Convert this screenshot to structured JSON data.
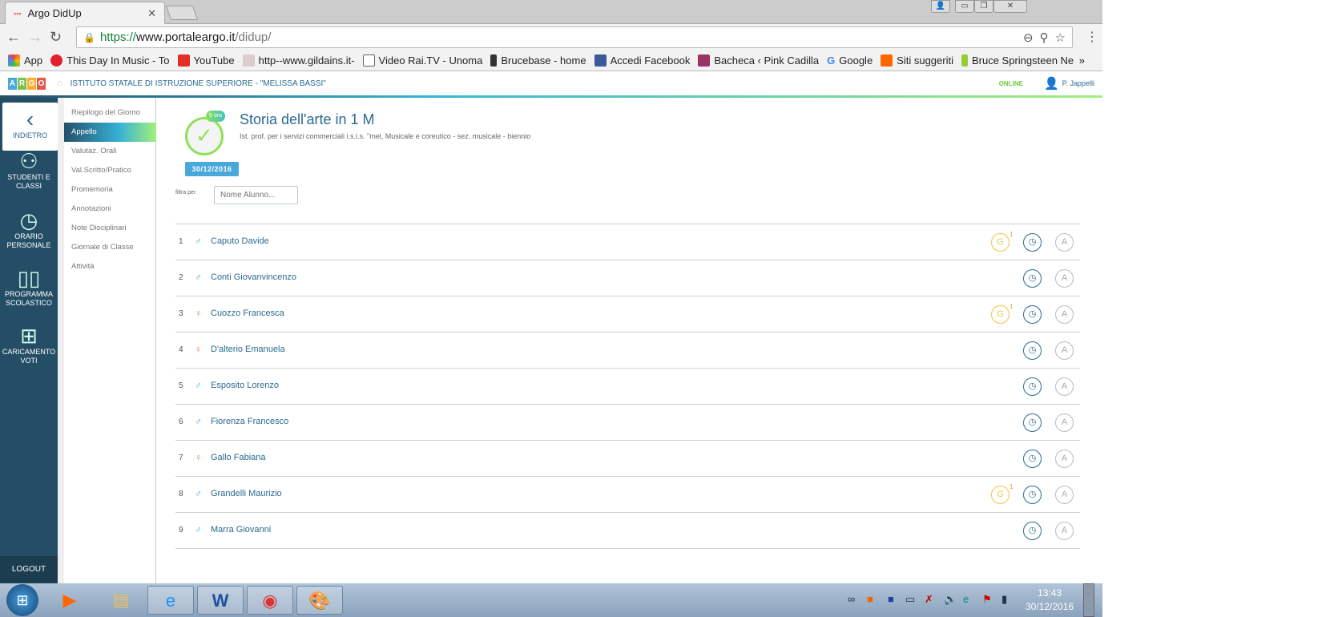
{
  "browser": {
    "tab_title": "Argo DidUp",
    "url_scheme": "https://",
    "url_host": "www.portaleargo.it",
    "url_path": "/didup/",
    "bookmarks": [
      "App",
      "This Day In Music - To",
      "YouTube",
      "http--www.gildains.it-",
      "Video Rai.TV - Unoma",
      "Brucebase - home",
      "Accedi  Facebook",
      "Bacheca ‹ Pink Cadilla",
      "Google",
      "Siti suggeriti",
      "Bruce Springsteen  Ne"
    ],
    "more": "»"
  },
  "header": {
    "logo": [
      "A",
      "R",
      "G",
      "O"
    ],
    "school": "ISTITUTO STATALE DI ISTRUZIONE SUPERIORE - \"MELISSA BASSI\"",
    "status": "ONLINE",
    "user": "P. Jappelli"
  },
  "sidebar": {
    "back": "INDIETRO",
    "items": [
      "STUDENTI E CLASSI",
      "ORARIO PERSONALE",
      "PROGRAMMA SCOLASTICO",
      "CARICAMENTO VOTI"
    ],
    "logout": "LOGOUT"
  },
  "submenu": [
    "Riepilogo del Giorno",
    "Appello",
    "Valutaz. Orali",
    "Val.Scritto/Pratico",
    "Promemoria",
    "Annotazioni",
    "Note Disciplinari",
    "Giornale di Classe",
    "Attività"
  ],
  "lesson": {
    "hour": "5 ora",
    "title": "Storia dell'arte in 1 M",
    "subtitle": "Ist. prof. per i servizi commerciali i.s.i.s. \"mel, Musicale e coreutico - sez. musicale - biennio",
    "date": "30/12/2016"
  },
  "filter": {
    "label": "filtra per",
    "placeholder": "Nome Alunno..."
  },
  "students": [
    {
      "n": "1",
      "gender": "male",
      "name": "Caputo Davide",
      "giustifica": true
    },
    {
      "n": "2",
      "gender": "male",
      "name": "Conti Giovanvincenzo",
      "giustifica": false
    },
    {
      "n": "3",
      "gender": "female",
      "name": "Cuozzo Francesca",
      "giustifica": true
    },
    {
      "n": "4",
      "gender": "female",
      "name": "D'alterio Emanuela",
      "giustifica": false
    },
    {
      "n": "5",
      "gender": "male",
      "name": "Esposito Lorenzo",
      "giustifica": false
    },
    {
      "n": "6",
      "gender": "male",
      "name": "Fiorenza Francesco",
      "giustifica": false
    },
    {
      "n": "7",
      "gender": "female",
      "name": "Gallo Fabiana",
      "giustifica": false
    },
    {
      "n": "8",
      "gender": "male",
      "name": "Grandelli Maurizio",
      "giustifica": true
    },
    {
      "n": "9",
      "gender": "male",
      "name": "Marra Giovanni",
      "giustifica": false
    }
  ],
  "row_buttons": {
    "g": "G",
    "g_count": "1",
    "a": "A"
  },
  "colors": {
    "accent": "#2a6a8f",
    "sidebar": "#244d66",
    "male": "#48a8dc",
    "female": "#f07860",
    "giustifica": "#f6c246",
    "online": "#6ccc3c"
  },
  "taskbar": {
    "time": "13:43",
    "date": "30/12/2016"
  }
}
